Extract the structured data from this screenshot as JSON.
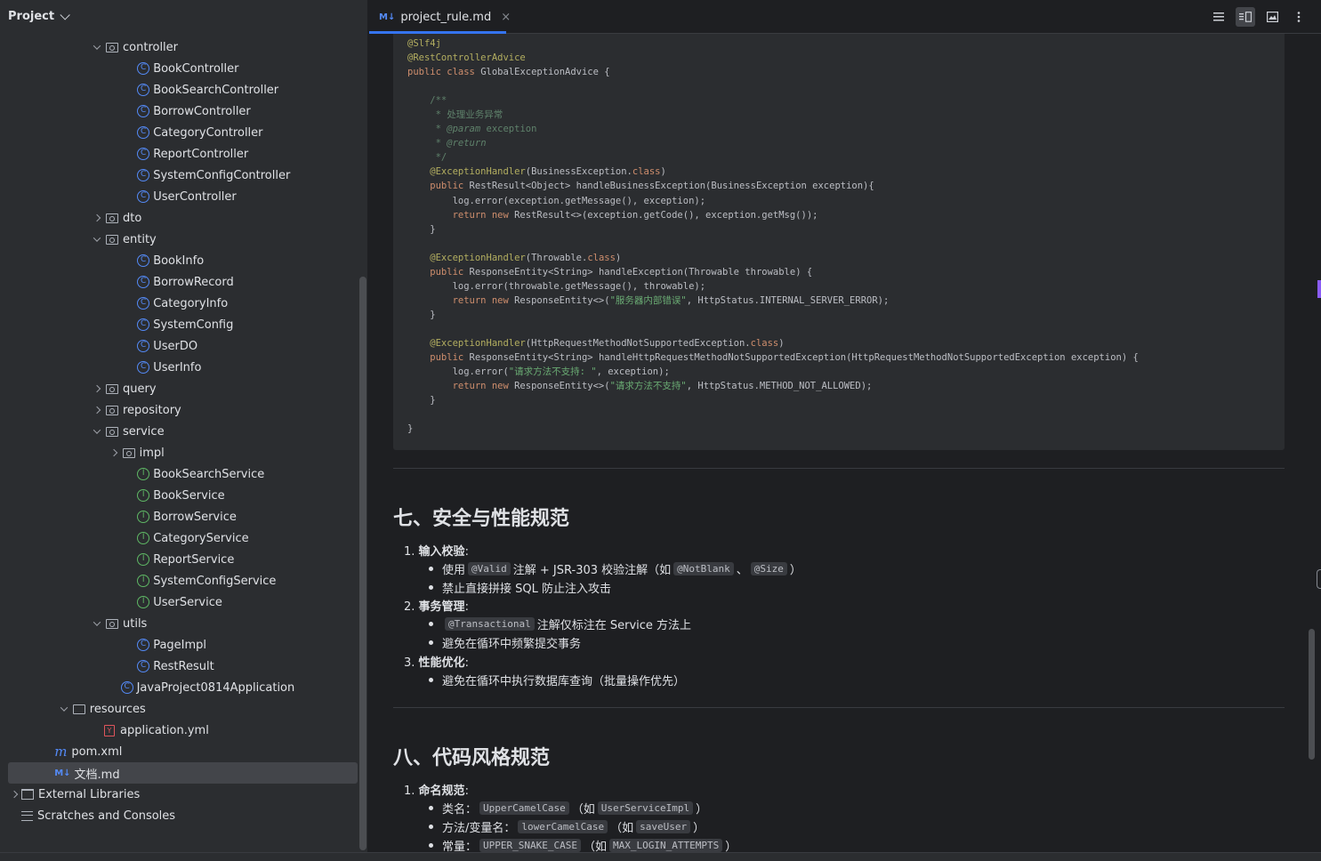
{
  "project_panel": {
    "title": "Project",
    "tree": [
      {
        "label": "controller",
        "kind": "pkg",
        "expanded": true,
        "depth": 5
      },
      {
        "label": "BookController",
        "kind": "class",
        "depth": 7
      },
      {
        "label": "BookSearchController",
        "kind": "class",
        "depth": 7
      },
      {
        "label": "BorrowController",
        "kind": "class",
        "depth": 7
      },
      {
        "label": "CategoryController",
        "kind": "class",
        "depth": 7
      },
      {
        "label": "ReportController",
        "kind": "class",
        "depth": 7
      },
      {
        "label": "SystemConfigController",
        "kind": "class",
        "depth": 7
      },
      {
        "label": "UserController",
        "kind": "class",
        "depth": 7
      },
      {
        "label": "dto",
        "kind": "pkg",
        "expanded": false,
        "depth": 5
      },
      {
        "label": "entity",
        "kind": "pkg",
        "expanded": true,
        "depth": 5
      },
      {
        "label": "BookInfo",
        "kind": "class",
        "depth": 7
      },
      {
        "label": "BorrowRecord",
        "kind": "class",
        "depth": 7
      },
      {
        "label": "CategoryInfo",
        "kind": "class",
        "depth": 7
      },
      {
        "label": "SystemConfig",
        "kind": "class",
        "depth": 7
      },
      {
        "label": "UserDO",
        "kind": "class",
        "depth": 7
      },
      {
        "label": "UserInfo",
        "kind": "class",
        "depth": 7
      },
      {
        "label": "query",
        "kind": "pkg",
        "expanded": false,
        "depth": 5
      },
      {
        "label": "repository",
        "kind": "pkg",
        "expanded": false,
        "depth": 5
      },
      {
        "label": "service",
        "kind": "pkg",
        "expanded": true,
        "depth": 5
      },
      {
        "label": "impl",
        "kind": "pkg",
        "expanded": false,
        "depth": 6
      },
      {
        "label": "BookSearchService",
        "kind": "interface",
        "depth": 7
      },
      {
        "label": "BookService",
        "kind": "interface",
        "depth": 7
      },
      {
        "label": "BorrowService",
        "kind": "interface",
        "depth": 7
      },
      {
        "label": "CategoryService",
        "kind": "interface",
        "depth": 7
      },
      {
        "label": "ReportService",
        "kind": "interface",
        "depth": 7
      },
      {
        "label": "SystemConfigService",
        "kind": "interface",
        "depth": 7
      },
      {
        "label": "UserService",
        "kind": "interface",
        "depth": 7
      },
      {
        "label": "utils",
        "kind": "pkg",
        "expanded": true,
        "depth": 5
      },
      {
        "label": "PageImpl",
        "kind": "class",
        "depth": 7
      },
      {
        "label": "RestResult",
        "kind": "class",
        "depth": 7
      },
      {
        "label": "JavaProject0814Application",
        "kind": "app",
        "depth": 6
      },
      {
        "label": "resources",
        "kind": "folder",
        "expanded": true,
        "depth": 3
      },
      {
        "label": "application.yml",
        "kind": "yml",
        "depth": 5
      },
      {
        "label": "pom.xml",
        "kind": "maven",
        "depth": 2
      },
      {
        "label": "文档.md",
        "kind": "md",
        "depth": 2,
        "selected": true
      },
      {
        "label": "External Libraries",
        "kind": "lib",
        "expanded": false,
        "depth": 0
      },
      {
        "label": "Scratches and Consoles",
        "kind": "scratch",
        "depth": 0
      }
    ]
  },
  "editor": {
    "tab": {
      "icon": "M↓",
      "label": "project_rule.md",
      "close": "×"
    },
    "toolbar_icons": [
      "editor-only-icon",
      "split-view-icon",
      "preview-only-icon",
      "more-icon"
    ],
    "code_lines": [
      [
        [
          "ann",
          "@Slf4j"
        ]
      ],
      [
        [
          "ann",
          "@RestControllerAdvice"
        ]
      ],
      [
        [
          "kw",
          "public class "
        ],
        [
          "",
          "GlobalExceptionAdvice {"
        ]
      ],
      [
        [
          "",
          ""
        ]
      ],
      [
        [
          "cm",
          "    /**"
        ]
      ],
      [
        [
          "cm",
          "     * 处理业务异常"
        ]
      ],
      [
        [
          "cm",
          "     * "
        ],
        [
          "cm-it",
          "@param"
        ],
        [
          "cm",
          " exception"
        ]
      ],
      [
        [
          "cm",
          "     * "
        ],
        [
          "cm-it",
          "@return"
        ]
      ],
      [
        [
          "cm",
          "     */"
        ]
      ],
      [
        [
          "ann",
          "    @ExceptionHandler"
        ],
        [
          "",
          "(BusinessException."
        ],
        [
          "kw",
          "class"
        ],
        [
          "",
          ")"
        ]
      ],
      [
        [
          "kw",
          "    public "
        ],
        [
          "",
          "RestResult<Object> handleBusinessException(BusinessException exception){"
        ]
      ],
      [
        [
          "",
          "        log.error(exception.getMessage(), exception);"
        ]
      ],
      [
        [
          "kw",
          "        return new "
        ],
        [
          "",
          "RestResult<>(exception.getCode(), exception.getMsg());"
        ]
      ],
      [
        [
          "",
          "    }"
        ]
      ],
      [
        [
          "",
          ""
        ]
      ],
      [
        [
          "ann",
          "    @ExceptionHandler"
        ],
        [
          "",
          "(Throwable."
        ],
        [
          "kw",
          "class"
        ],
        [
          "",
          ")"
        ]
      ],
      [
        [
          "kw",
          "    public "
        ],
        [
          "",
          "ResponseEntity<String> handleException(Throwable throwable) {"
        ]
      ],
      [
        [
          "",
          "        log.error(throwable.getMessage(), throwable);"
        ]
      ],
      [
        [
          "kw",
          "        return new "
        ],
        [
          "",
          "ResponseEntity<>("
        ],
        [
          "str",
          "\"服务器内部错误\""
        ],
        [
          "",
          ", HttpStatus.INTERNAL_SERVER_ERROR);"
        ]
      ],
      [
        [
          "",
          "    }"
        ]
      ],
      [
        [
          "",
          ""
        ]
      ],
      [
        [
          "ann",
          "    @ExceptionHandler"
        ],
        [
          "",
          "(HttpRequestMethodNotSupportedException."
        ],
        [
          "kw",
          "class"
        ],
        [
          "",
          ")"
        ]
      ],
      [
        [
          "kw",
          "    public "
        ],
        [
          "",
          "ResponseEntity<String> handleHttpRequestMethodNotSupportedException(HttpRequestMethodNotSupportedException exception) {"
        ]
      ],
      [
        [
          "",
          "        log.error("
        ],
        [
          "str",
          "\"请求方法不支持: \""
        ],
        [
          "",
          ", exception);"
        ]
      ],
      [
        [
          "kw",
          "        return new "
        ],
        [
          "",
          "ResponseEntity<>("
        ],
        [
          "str",
          "\"请求方法不支持\""
        ],
        [
          "",
          ", HttpStatus.METHOD_NOT_ALLOWED);"
        ]
      ],
      [
        [
          "",
          "    }"
        ]
      ],
      [
        [
          "",
          ""
        ]
      ],
      [
        [
          "",
          "}"
        ]
      ]
    ],
    "section7": {
      "heading": "七、安全与性能规范",
      "items": [
        {
          "num": "1.",
          "title": "输入校验",
          "colon": ":"
        },
        {
          "num": "2.",
          "title": "事务管理",
          "colon": ":"
        },
        {
          "num": "3.",
          "title": "性能优化",
          "colon": ":"
        }
      ],
      "sub": {
        "s1a_pre": "使用",
        "s1a_code1": "@Valid",
        "s1a_mid": "注解 + JSR-303 校验注解（如",
        "s1a_code2": "@NotBlank",
        "s1a_sep": "、",
        "s1a_code3": "@Size",
        "s1a_post": "）",
        "s1b": "禁止直接拼接 SQL 防止注入攻击",
        "s2a_code": "@Transactional",
        "s2a_post": "注解仅标注在 Service 方法上",
        "s2b": "避免在循环中频繁提交事务",
        "s3a": "避免在循环中执行数据库查询（批量操作优先）"
      }
    },
    "section8": {
      "heading": "八、代码风格规范",
      "item1": {
        "num": "1.",
        "title": "命名规范",
        "colon": ":"
      },
      "sub": {
        "a_label": "类名：",
        "a_code": "UpperCamelCase",
        "a_mid": "（如",
        "a_code2": "UserServiceImpl",
        "a_post": "）",
        "b_label": "方法/变量名：",
        "b_code": "lowerCamelCase",
        "b_mid": "（如",
        "b_code2": "saveUser",
        "b_post": "）",
        "c_label": "常量：",
        "c_code": "UPPER_SNAKE_CASE",
        "c_mid": "（如",
        "c_code2": "MAX_LOGIN_ATTEMPTS",
        "c_post": "）"
      }
    }
  }
}
